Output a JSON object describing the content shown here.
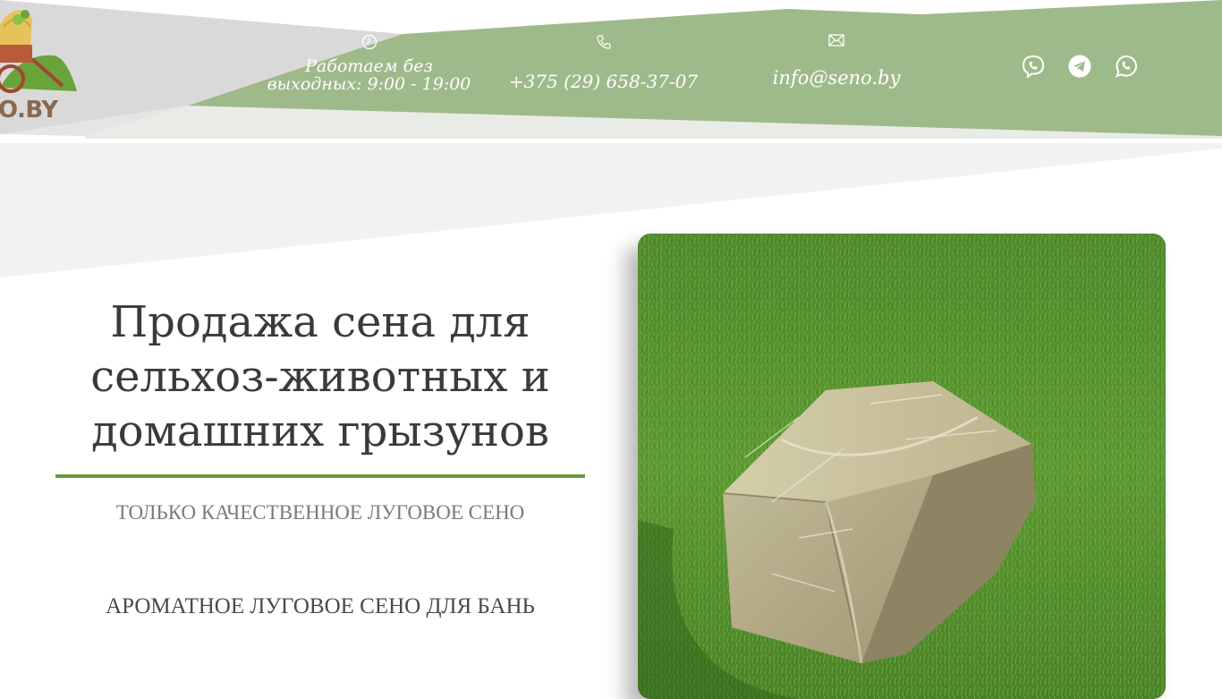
{
  "brand": {
    "logo_text": "O.BY"
  },
  "header": {
    "hours": "Работаем без выходных: 9:00 - 19:00",
    "phone": "+375 (29) 658-37-07",
    "email": "info@seno.by"
  },
  "socials": [
    "viber-icon",
    "telegram-icon",
    "whatsapp-icon"
  ],
  "hero": {
    "title": "Продажа сена для сельхоз-животных и домашних грызунов",
    "subtitle": "ТОЛЬКО КАЧЕСТВЕННОЕ ЛУГОВОЕ СЕНО",
    "subtitle2": "АРОМАТНОЕ ЛУГОВОЕ СЕНО ДЛЯ БАНЬ"
  },
  "colors": {
    "accent_green": "#9fba8a",
    "underline_green": "#6b9a3a",
    "title_text": "#3a3a3a",
    "light_gray": "#f2f2f2"
  }
}
